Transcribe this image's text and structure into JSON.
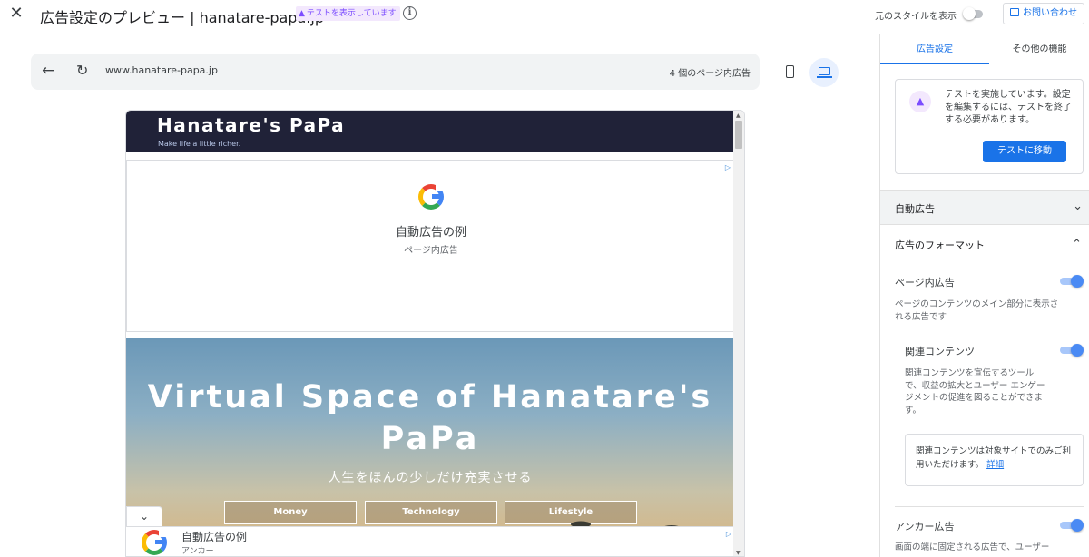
{
  "header": {
    "close_icon": "close-icon",
    "title": "広告設定のプレビュー | hanatare-papa.jp",
    "test_badge": "テストを表示しています",
    "orig_style_label": "元のスタイルを表示",
    "orig_style_on": false,
    "contact_label": "お問い合わせ"
  },
  "browser": {
    "url": "www.hanatare-papa.jp",
    "ad_count": "4 個のページ内広告",
    "device_selected": "desktop"
  },
  "site": {
    "name": "Hanatare's PaPa",
    "tagline": "Make life a little richer.",
    "hero_title": "Virtual Space of Hanatare's PaPa",
    "hero_subtitle": "人生をほんの少しだけ充実させる",
    "nav_buttons": [
      "Money",
      "Technology",
      "Lifestyle"
    ]
  },
  "ads": {
    "inpage_title": "自動広告の例",
    "inpage_sub": "ページ内広告",
    "anchor_title": "自動広告の例",
    "anchor_sub": "アンカー"
  },
  "panel": {
    "tabs": [
      "広告設定",
      "その他の機能"
    ],
    "active_tab": 0,
    "notice_text": "テストを実施しています。設定を編集するには、テストを終了する必要があります。",
    "notice_button": "テストに移動",
    "auto_ads_label": "自動広告",
    "format_label": "広告のフォーマット",
    "inpage_label": "ページ内広告",
    "inpage_desc": "ページのコンテンツのメイン部分に表示される広告です",
    "inpage_on": true,
    "related_label": "関連コンテンツ",
    "related_desc": "関連コンテンツを宣伝するツールで、収益の拡大とユーザー エンゲージメントの促進を図ることができます。",
    "related_on": true,
    "related_note": "関連コンテンツは対象サイトでのみご利用いただけます。",
    "related_link": "詳細",
    "anchor_label": "アンカー広告",
    "anchor_desc": "画面の端に固定される広告で、ユーザー",
    "anchor_on": true
  },
  "colors": {
    "accent": "#1a73e8",
    "test_purple": "#7c4dff",
    "site_header": "#202238"
  }
}
